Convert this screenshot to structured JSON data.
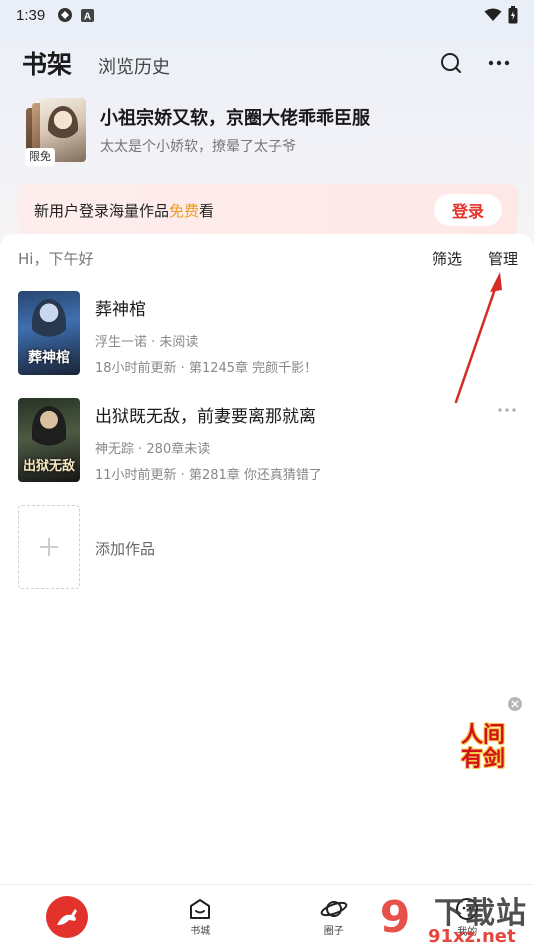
{
  "status_bar": {
    "time": "1:39"
  },
  "header": {
    "title": "书架",
    "history_tab": "浏览历史"
  },
  "recommend": {
    "badge": "限免",
    "title": "小祖宗娇又软，京圈大佬乖乖臣服",
    "subtitle": "太太是个小娇软，撩晕了太子爷"
  },
  "login_banner": {
    "text_before": "新用户登录海量作品",
    "text_free": "免费",
    "text_after": "看",
    "button": "登录",
    "free_color": "#f29a1e"
  },
  "shelf": {
    "greeting": "Hi，下午好",
    "filter_label": "筛选",
    "manage_label": "管理",
    "books": [
      {
        "cover_title": "葬神棺",
        "title": "葬神棺",
        "meta": "浮生一诺 · 未阅读",
        "update": "18小时前更新 · 第1245章 完颜千影！"
      },
      {
        "cover_title": "出狱无敌",
        "title": "出狱既无敌，前妻要离那就离",
        "meta": "神无踪 · 280章未读",
        "update": "11小时前更新 · 第281章 你还真猜错了"
      }
    ],
    "add_label": "添加作品"
  },
  "float_ad": {
    "logo_text": "人间有剑"
  },
  "bottom_nav": {
    "items": [
      {
        "label": ""
      },
      {
        "label": "书城"
      },
      {
        "label": "圈子"
      },
      {
        "label": "我的"
      }
    ]
  },
  "watermark": {
    "title": "下载站",
    "url": "91xz.net"
  },
  "colors": {
    "accent": "#e2322b",
    "arrow": "#d62a25"
  }
}
